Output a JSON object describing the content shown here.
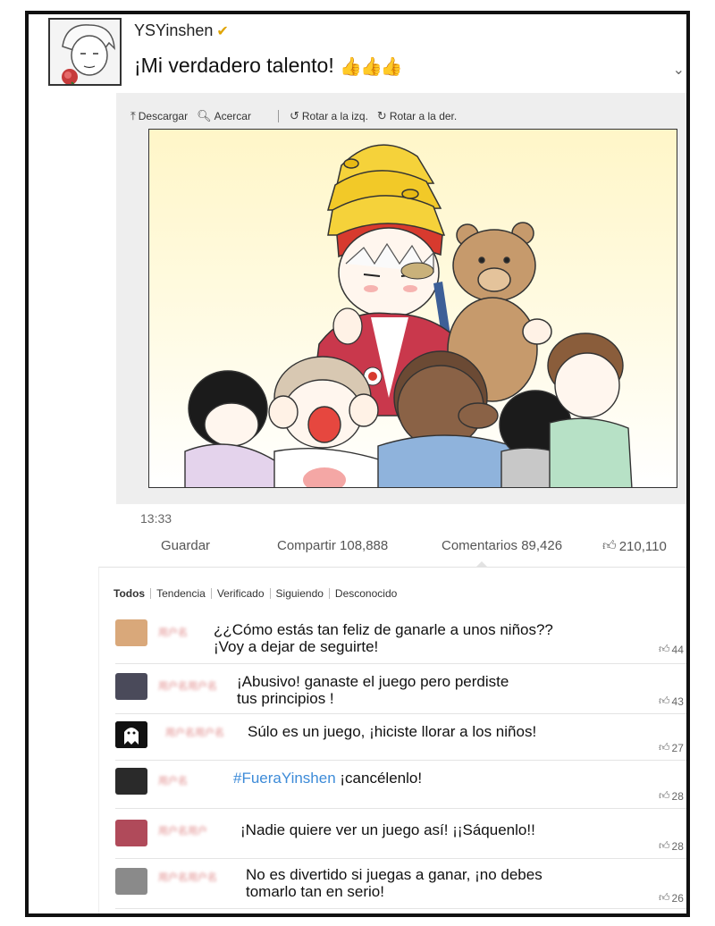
{
  "post": {
    "username": "YSYinshen",
    "verified_icon": "verified-v-icon",
    "text": "¡Mi verdadero talento!",
    "emoji": "👍👍👍"
  },
  "viewer": {
    "toolbar": [
      {
        "label": "Descargar",
        "icon": "download-icon"
      },
      {
        "label": "Acercar",
        "icon": "zoom-icon"
      },
      {
        "label": "Rotar a la izq.",
        "icon": "rotate-left-icon"
      },
      {
        "label": "Rotar a la der.",
        "icon": "rotate-right-icon"
      }
    ]
  },
  "meta": {
    "time": "13:33",
    "save": "Guardar",
    "share": "Compartir 108,888",
    "comments": "Comentarios 89,426",
    "likes": "210,110"
  },
  "filters": [
    "Todos",
    "Tendencia",
    "Verificado",
    "Siguiendo",
    "Desconocido"
  ],
  "comments": [
    {
      "name": "用户名",
      "text": "¿¿Cómo estás tan feliz de ganarle a unos niños??\n¡Voy a dejar de seguirte!",
      "likes": "44"
    },
    {
      "name": "用户名用户名",
      "text": "¡Abusivo! ganaste el juego pero perdiste\ntus principios !",
      "likes": "43"
    },
    {
      "name": "用户名用户名",
      "text": "Súlo es un juego, ¡hiciste llorar a los niños!",
      "likes": "27"
    },
    {
      "name": "用户名",
      "hashtag": "#FueraYinshen",
      "text": " ¡cancélenlo!",
      "likes": "28"
    },
    {
      "name": "用户名用户",
      "text": "¡Nadie quiere ver un juego así! ¡¡Sáquenlo!!",
      "likes": "28"
    },
    {
      "name": "用户名用户名",
      "text": "No es divertido si juegas a ganar, ¡no debes\ntomarlo tan en serio!",
      "likes": "26"
    }
  ],
  "colors": {
    "hashtag": "#3d8bd8",
    "verified": "#e0a400",
    "username_blur": "#e08a8a"
  }
}
